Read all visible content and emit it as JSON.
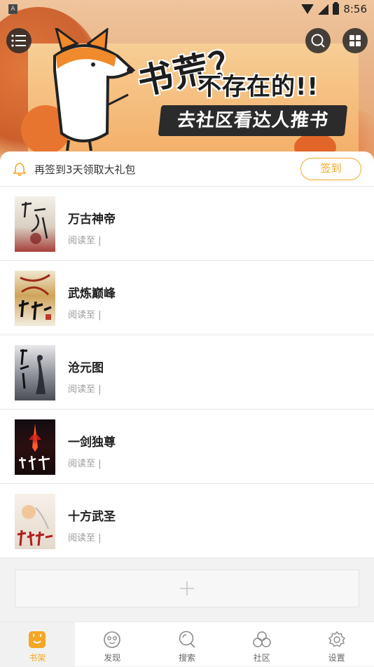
{
  "status_bar": {
    "time": "8:56",
    "left_badge": "A"
  },
  "banner": {
    "headline": "书荒？",
    "subline": "不存在的!!",
    "cta": "去社区看达人推书"
  },
  "sign_in": {
    "text": "再签到3天领取大礼包",
    "button": "签到"
  },
  "books": [
    {
      "title": "万古神帝",
      "progress": "阅读至 |"
    },
    {
      "title": "武炼巅峰",
      "progress": "阅读至 |"
    },
    {
      "title": "沧元图",
      "progress": "阅读至 |"
    },
    {
      "title": "一剑独尊",
      "progress": "阅读至 |"
    },
    {
      "title": "十方武圣",
      "progress": "阅读至 |"
    }
  ],
  "add_button": {
    "icon": "plus-icon"
  },
  "nav": [
    {
      "label": "书架",
      "icon": "bookshelf-icon"
    },
    {
      "label": "发现",
      "icon": "discover-icon"
    },
    {
      "label": "搜索",
      "icon": "search-icon"
    },
    {
      "label": "社区",
      "icon": "community-icon"
    },
    {
      "label": "设置",
      "icon": "settings-icon"
    }
  ],
  "colors": {
    "accent": "#f5a623",
    "dark_button": "#2b2b2b"
  }
}
